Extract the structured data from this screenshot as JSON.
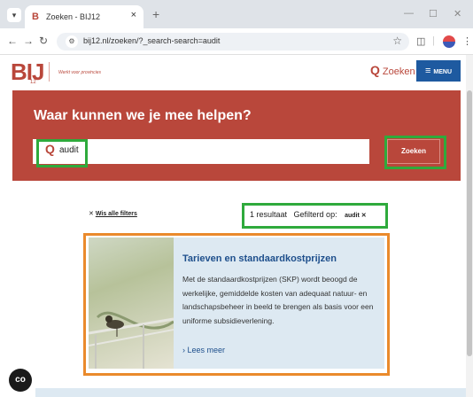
{
  "browser": {
    "tab_title": "Zoeken - BIJ12",
    "tab_favicon": "B",
    "tab_close": "×",
    "new_tab": "+",
    "url": "bij12.nl/zoeken/?_search-search=audit"
  },
  "header": {
    "logo": "BIJ",
    "logo_sub": "12",
    "tagline": "Werkt voor provincies",
    "search_link": "Zoeken",
    "menu_label": "MENU"
  },
  "hero": {
    "title": "Waar kunnen we je mee helpen?",
    "search_value": "audit",
    "search_button": "Zoeken"
  },
  "filters": {
    "clear_all": "Wis alle filters",
    "result_count": "1 resultaat",
    "filtered_on_label": "Gefilterd op:",
    "active_filter": "audit"
  },
  "results": [
    {
      "title": "Tarieven en standaardkostprijzen",
      "description": "Met de standaardkostprijzen (SKP) wordt beoogd de werkelijke, gemiddelde kosten van adequaat natuur- en landschapsbeheer in beeld te brengen als basis voor een uniforme subsidieverlening.",
      "more": "Lees meer"
    }
  ],
  "colors": {
    "brand": "#b9473b",
    "link": "#1e4f8c",
    "menu": "#1e5aa0",
    "highlight_green": "#2faa3c",
    "highlight_orange": "#ea8a2c"
  }
}
